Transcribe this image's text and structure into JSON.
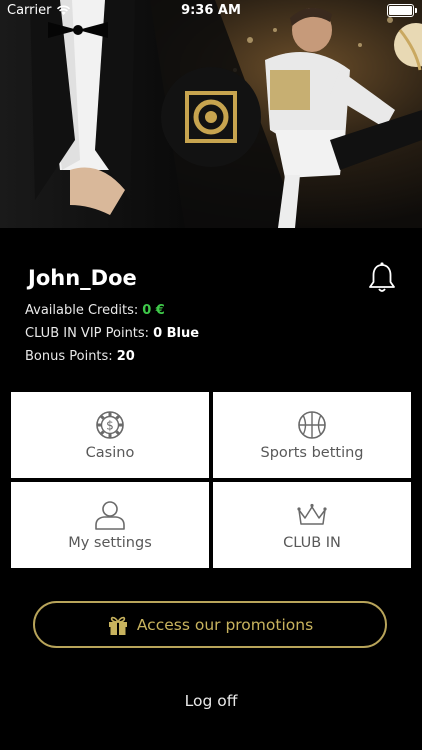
{
  "status_bar": {
    "carrier": "Carrier",
    "time": "9:36 AM"
  },
  "profile": {
    "username": "John_Doe",
    "credits_label": "Available Credits:",
    "credits_value": "0 €",
    "vip_label": "CLUB IN VIP Points:",
    "vip_value": "0 Blue",
    "bonus_label": "Bonus Points:",
    "bonus_value": "20"
  },
  "menu": {
    "casino": "Casino",
    "sports": "Sports betting",
    "settings": "My settings",
    "club": "CLUB IN"
  },
  "promo_label": "Access our promotions",
  "logoff_label": "Log off",
  "colors": {
    "accent_gold": "#c8b35e",
    "credit_green": "#3fc94a"
  }
}
